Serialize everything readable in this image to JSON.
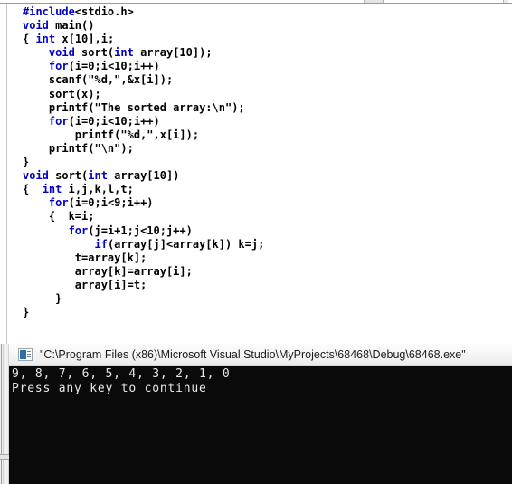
{
  "window": {
    "top_strip_name": "cut-off-toolbar-strip"
  },
  "editor": {
    "name": "code-editor",
    "language": "c",
    "lines": [
      [
        {
          "t": "#include",
          "c": "pp"
        },
        {
          "t": "<stdio.h>",
          "c": ""
        }
      ],
      [
        {
          "t": "void",
          "c": "kw"
        },
        {
          "t": " main()",
          "c": ""
        }
      ],
      [
        {
          "t": "{ ",
          "c": ""
        },
        {
          "t": "int",
          "c": "kw"
        },
        {
          "t": " x[10],i;",
          "c": ""
        }
      ],
      [
        {
          "t": "    ",
          "c": ""
        },
        {
          "t": "void",
          "c": "kw"
        },
        {
          "t": " sort(",
          "c": ""
        },
        {
          "t": "int",
          "c": "kw"
        },
        {
          "t": " array[10]);",
          "c": ""
        }
      ],
      [
        {
          "t": "    ",
          "c": ""
        },
        {
          "t": "for",
          "c": "kw"
        },
        {
          "t": "(i=0;i<10;i++)",
          "c": ""
        }
      ],
      [
        {
          "t": "    scanf(\"%d,\",&x[i]);",
          "c": ""
        }
      ],
      [
        {
          "t": "    sort(x);",
          "c": ""
        }
      ],
      [
        {
          "t": "    printf(\"The sorted array:\\n\");",
          "c": ""
        }
      ],
      [
        {
          "t": "    ",
          "c": ""
        },
        {
          "t": "for",
          "c": "kw"
        },
        {
          "t": "(i=0;i<10;i++)",
          "c": ""
        }
      ],
      [
        {
          "t": "        printf(\"%d,\",x[i]);",
          "c": ""
        }
      ],
      [
        {
          "t": "    printf(\"\\n\");",
          "c": ""
        }
      ],
      [
        {
          "t": "}",
          "c": ""
        }
      ],
      [
        {
          "t": "void",
          "c": "kw"
        },
        {
          "t": " sort(",
          "c": ""
        },
        {
          "t": "int",
          "c": "kw"
        },
        {
          "t": " array[10])",
          "c": ""
        }
      ],
      [
        {
          "t": "{  ",
          "c": ""
        },
        {
          "t": "int",
          "c": "kw"
        },
        {
          "t": " i,j,k,l,t;",
          "c": ""
        }
      ],
      [
        {
          "t": "    ",
          "c": ""
        },
        {
          "t": "for",
          "c": "kw"
        },
        {
          "t": "(i=0;i<9;i++)",
          "c": ""
        }
      ],
      [
        {
          "t": "    {  k=i;",
          "c": ""
        }
      ],
      [
        {
          "t": "       ",
          "c": ""
        },
        {
          "t": "for",
          "c": "kw"
        },
        {
          "t": "(j=i+1;j<10;j++)",
          "c": ""
        }
      ],
      [
        {
          "t": "           ",
          "c": ""
        },
        {
          "t": "if",
          "c": "kw"
        },
        {
          "t": "(array[j]<array[k]) k=j;",
          "c": ""
        }
      ],
      [
        {
          "t": "        t=array[k];",
          "c": ""
        }
      ],
      [
        {
          "t": "        array[k]=array[i];",
          "c": ""
        }
      ],
      [
        {
          "t": "        array[i]=t;",
          "c": ""
        }
      ],
      [
        {
          "t": "     }",
          "c": ""
        }
      ],
      [
        {
          "t": "}",
          "c": ""
        }
      ]
    ],
    "colors": {
      "keyword": "#0000c8",
      "text": "#000000",
      "background": "#ffffff"
    }
  },
  "console": {
    "name": "console-window",
    "title": "\"C:\\Program Files (x86)\\Microsoft Visual Studio\\MyProjects\\68468\\Debug\\68468.exe\"",
    "icon": "console-app-icon",
    "output_lines": [
      "9, 8, 7, 6, 5, 4, 3, 2, 1, 0",
      "Press any key to continue"
    ],
    "colors": {
      "background": "#0a0a0a",
      "text": "#e8e8e8",
      "titlebar": "#f4f4f4"
    }
  }
}
